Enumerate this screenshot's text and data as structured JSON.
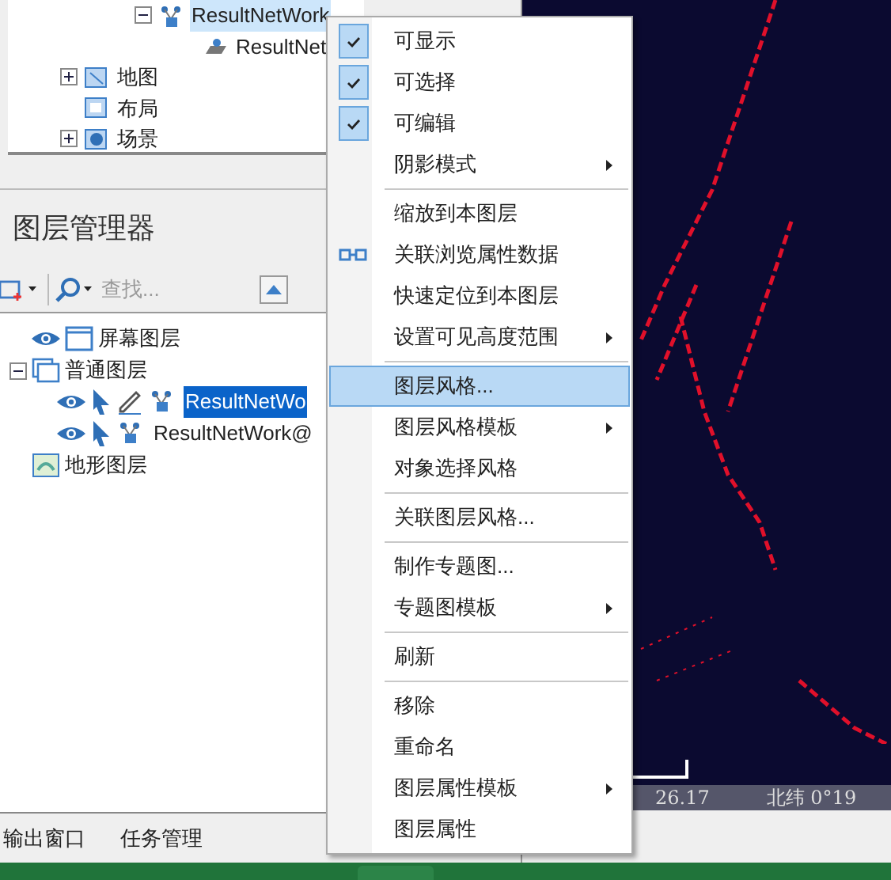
{
  "project_tree": {
    "items": [
      {
        "label": "ResultNetWork",
        "kind": "network",
        "expanded": true,
        "selected": true,
        "children": [
          {
            "label": "ResultNet",
            "kind": "dataset",
            "selected": false
          }
        ]
      },
      {
        "label": "地图",
        "kind": "map",
        "expanded": false,
        "selected": false
      },
      {
        "label": "布局",
        "kind": "layout",
        "selected": false
      },
      {
        "label": "场景",
        "kind": "scene",
        "expanded": false,
        "selected": false
      }
    ]
  },
  "layer_manager": {
    "title": "图层管理器",
    "search": {
      "placeholder": "查找..."
    },
    "layers": [
      {
        "label": "屏幕图层",
        "kind": "screen"
      },
      {
        "label": "普通图层",
        "kind": "group",
        "expanded": true,
        "children": [
          {
            "label": "ResultNetWo",
            "selected": true,
            "visible": true,
            "selectable": true,
            "editable": true
          },
          {
            "label": "ResultNetWork@",
            "selected": false,
            "visible": true,
            "selectable": true,
            "editable": false
          }
        ]
      },
      {
        "label": "地形图层",
        "kind": "terrain"
      }
    ]
  },
  "context_menu": [
    {
      "kind": "item",
      "label": "可显示",
      "checked": true,
      "submenu": false,
      "selected": false
    },
    {
      "kind": "item",
      "label": "可选择",
      "checked": true,
      "submenu": false,
      "selected": false
    },
    {
      "kind": "item",
      "label": "可编辑",
      "checked": true,
      "submenu": false,
      "selected": false
    },
    {
      "kind": "item",
      "label": "阴影模式",
      "checked": false,
      "submenu": true,
      "selected": false
    },
    {
      "kind": "separator"
    },
    {
      "kind": "item",
      "label": "缩放到本图层",
      "checked": false,
      "submenu": false,
      "selected": false
    },
    {
      "kind": "link_item",
      "label": "关联浏览属性数据",
      "checked": false,
      "submenu": false,
      "selected": false
    },
    {
      "kind": "item",
      "label": "快速定位到本图层",
      "checked": false,
      "submenu": false,
      "selected": false
    },
    {
      "kind": "item",
      "label": "设置可见高度范围",
      "checked": false,
      "submenu": true,
      "selected": false
    },
    {
      "kind": "separator"
    },
    {
      "kind": "item",
      "label": "图层风格...",
      "checked": false,
      "submenu": false,
      "selected": true
    },
    {
      "kind": "item",
      "label": "图层风格模板",
      "checked": false,
      "submenu": true,
      "selected": false
    },
    {
      "kind": "item",
      "label": "对象选择风格",
      "checked": false,
      "submenu": false,
      "selected": false
    },
    {
      "kind": "separator"
    },
    {
      "kind": "item",
      "label": "关联图层风格...",
      "checked": false,
      "submenu": false,
      "selected": false
    },
    {
      "kind": "separator"
    },
    {
      "kind": "item",
      "label": "制作专题图...",
      "checked": false,
      "submenu": false,
      "selected": false
    },
    {
      "kind": "item",
      "label": "专题图模板",
      "checked": false,
      "submenu": true,
      "selected": false
    },
    {
      "kind": "separator"
    },
    {
      "kind": "item",
      "label": "刷新",
      "checked": false,
      "submenu": false,
      "selected": false
    },
    {
      "kind": "separator"
    },
    {
      "kind": "item",
      "label": "移除",
      "checked": false,
      "submenu": false,
      "selected": false
    },
    {
      "kind": "item",
      "label": "重命名",
      "checked": false,
      "submenu": false,
      "selected": false
    },
    {
      "kind": "item",
      "label": "图层属性模板",
      "checked": false,
      "submenu": true,
      "selected": false
    },
    {
      "kind": "item",
      "label": "图层属性",
      "checked": false,
      "submenu": false,
      "selected": false
    }
  ],
  "map_status": {
    "value": "26.17",
    "latitude": "北纬 0°19"
  },
  "bottom_tabs": [
    {
      "label": "输出窗口"
    },
    {
      "label": "任务管理"
    }
  ]
}
